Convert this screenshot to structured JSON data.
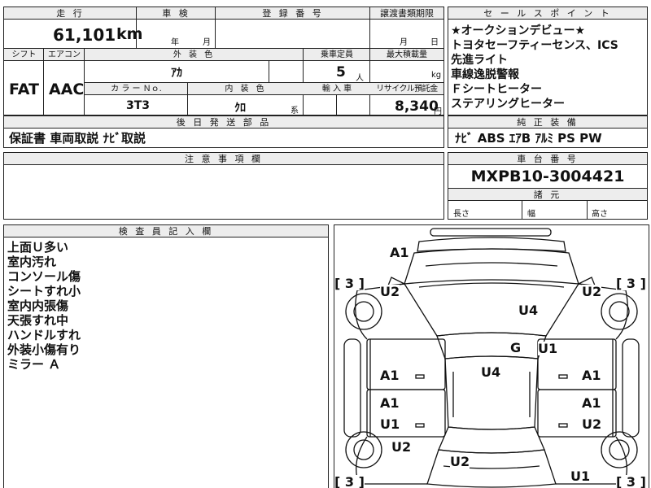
{
  "top_row": {
    "mileage_header": "走 行",
    "mileage_value": "61,101",
    "mileage_unit": "km",
    "inspection_header": "車 検",
    "inspection_year": "年",
    "inspection_month": "月",
    "registration_header": "登 録 番 号",
    "transfer_header": "譲渡書類期限",
    "transfer_month": "月",
    "transfer_day": "日"
  },
  "second_row": {
    "shift_header": "シフト",
    "aircon_header": "エアコン",
    "shift_value": "FAT",
    "aircon_value": "AAC",
    "exterior_color_header": "外 装 色",
    "exterior_color_value": "ｱｶ",
    "seating_header": "乗車定員",
    "seating_value": "5",
    "seating_unit": "人",
    "max_load_header": "最大積載量",
    "max_load_unit": "kg",
    "color_no_header": "カ ラ ー Ｎｏ.",
    "color_no_value": "3T3",
    "interior_color_header": "内 装 色",
    "interior_color_value": "ｸﾛ",
    "interior_suffix": "系",
    "import_header": "輸 入 車",
    "recycle_header": "リサイクル預託金",
    "recycle_value": "8,340",
    "recycle_unit": "円"
  },
  "later_parts": {
    "header": "後 日 発 送 部 品",
    "value": "保証書 車両取説 ﾅﾋﾞ取説"
  },
  "selling_points": {
    "header": "セ ー ル ス ポ イ ン ト",
    "lines": [
      "★オークションデビュー★",
      "トヨタセーフティーセンス、ICS",
      "先進ライト",
      "車線逸脱警報",
      "Ｆシートヒーター",
      "ステアリングヒーター"
    ]
  },
  "equipment": {
    "header": "純 正 装 備",
    "value": "ﾅﾋﾞ ABS ｴｱB ｱﾙﾐ PS PW"
  },
  "notes": {
    "header": "注 意 事 項 欄"
  },
  "chassis": {
    "header": "車 台 番 号",
    "value": "MXPB10-3004421"
  },
  "dimensions": {
    "header": "諸 元",
    "length_label": "長さ",
    "width_label": "幅",
    "height_label": "高さ"
  },
  "inspector": {
    "header": "検 査 員 記 入 欄",
    "lines": [
      "上面Ｕ多い",
      "室内汚れ",
      "コンソール傷",
      "シートすれ小",
      "室内内張傷",
      "天張すれ中",
      "ハンドルすれ",
      "外装小傷有り",
      "ミラー Ａ"
    ]
  },
  "diagram": {
    "labels": {
      "roof_front": "A1",
      "front_left": "U2",
      "front_right": "U2",
      "hood_right": "U4",
      "glass": "G",
      "pillar_right": "U1",
      "cabin": "U4",
      "door_fl": "A1",
      "door_fr": "A1",
      "door_rl_a": "A1",
      "door_rl_u": "U1",
      "door_rr_a": "A1",
      "door_rr_u": "U2",
      "rear_left": "U2",
      "trunk": "U2",
      "rear_right": "U1"
    },
    "brackets": {
      "top_left": "[ 3 ]",
      "top_right": "[ 3 ]",
      "bottom_left": "[ 3 ]",
      "bottom_right": "[ 3 ]"
    }
  }
}
